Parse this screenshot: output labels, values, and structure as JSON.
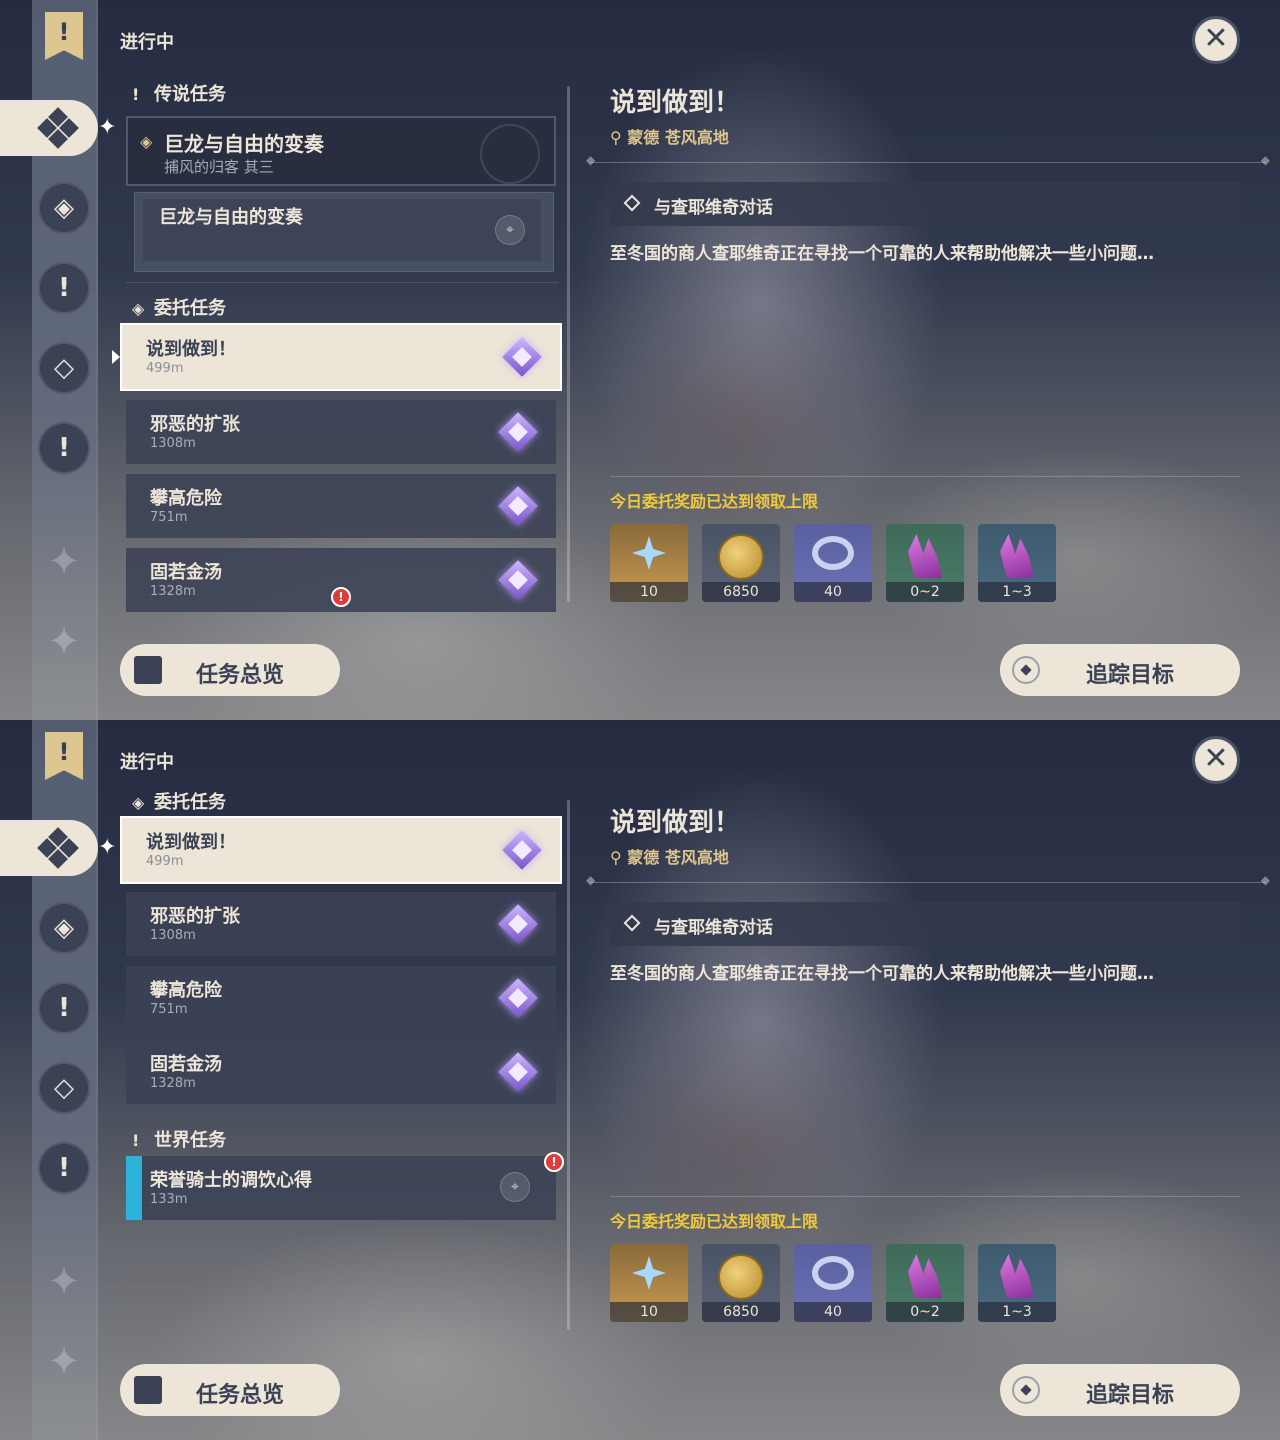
{
  "panels": [
    {
      "status_label": "进行中",
      "categories": {
        "archon": "传说任务",
        "commission": "委托任务"
      },
      "archon_quest": {
        "title": "巨龙与自由的变奏",
        "subtitle": "捕风的归客 其三",
        "sub_entry": "巨龙与自由的变奏"
      },
      "commissions": [
        {
          "title": "说到做到！",
          "distance": "499m"
        },
        {
          "title": "邪恶的扩张",
          "distance": "1308m"
        },
        {
          "title": "攀高危险",
          "distance": "751m"
        },
        {
          "title": "固若金汤",
          "distance": "1328m"
        }
      ],
      "overview_button": "任务总览",
      "track_button": "追踪目标",
      "detail": {
        "title": "说到做到！",
        "location": "蒙德 苍风高地",
        "objective": "与查耶维奇对话",
        "description": "至冬国的商人查耶维奇正在寻找一个可靠的人来帮助他解决一些小问题…",
        "reward_note": "今日委托奖励已达到领取上限",
        "rewards": [
          {
            "icon": "primogem-icon",
            "qty": "10"
          },
          {
            "icon": "mora-icon",
            "qty": "6850"
          },
          {
            "icon": "friendship-exp-icon",
            "qty": "40"
          },
          {
            "icon": "ore-crystal-icon",
            "qty": "0~2"
          },
          {
            "icon": "ore-crystal-icon",
            "qty": "1~3"
          }
        ]
      }
    },
    {
      "status_label": "进行中",
      "categories": {
        "commission": "委托任务",
        "world": "世界任务"
      },
      "commissions": [
        {
          "title": "说到做到！",
          "distance": "499m"
        },
        {
          "title": "邪恶的扩张",
          "distance": "1308m"
        },
        {
          "title": "攀高危险",
          "distance": "751m"
        },
        {
          "title": "固若金汤",
          "distance": "1328m"
        }
      ],
      "world_quest": {
        "title": "荣誉骑士的调饮心得",
        "distance": "133m"
      },
      "overview_button": "任务总览",
      "track_button": "追踪目标",
      "detail": {
        "title": "说到做到！",
        "location": "蒙德 苍风高地",
        "objective": "与查耶维奇对话",
        "description": "至冬国的商人查耶维奇正在寻找一个可靠的人来帮助他解决一些小问题…",
        "reward_note": "今日委托奖励已达到领取上限",
        "rewards": [
          {
            "icon": "primogem-icon",
            "qty": "10"
          },
          {
            "icon": "mora-icon",
            "qty": "6850"
          },
          {
            "icon": "friendship-exp-icon",
            "qty": "40"
          },
          {
            "icon": "ore-crystal-icon",
            "qty": "0~2"
          },
          {
            "icon": "ore-crystal-icon",
            "qty": "1~3"
          }
        ]
      }
    }
  ]
}
